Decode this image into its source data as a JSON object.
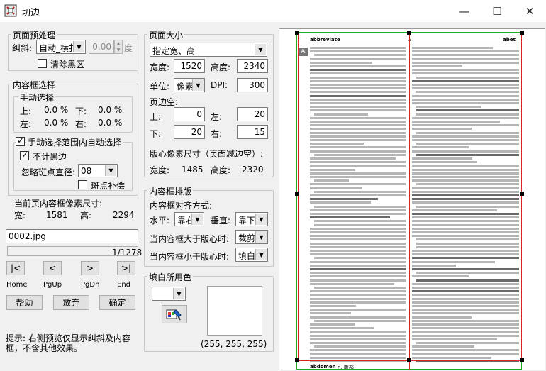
{
  "window": {
    "title": "切边"
  },
  "prep": {
    "group_title": "页面预处理",
    "skew_label": "纠斜:",
    "skew_mode": "自动_横扌",
    "skew_value": "0.00",
    "skew_unit": "度",
    "clear_black_label": "清除黑区"
  },
  "content_select": {
    "group_title": "内容框选择",
    "manual_title": "手动选择",
    "top_label": "上:",
    "top_value": "0.0 %",
    "bottom_label": "下:",
    "bottom_value": "0.0 %",
    "left_label": "左:",
    "left_value": "0.0 %",
    "right_label": "右:",
    "right_value": "0.0 %",
    "auto_label": "手动选择范围内自动选择",
    "exclude_border_label": "不计黑边",
    "ignore_dot_label": "忽略斑点直径:",
    "ignore_dot_value": "08",
    "dot_fill_label": "斑点补偿"
  },
  "current_size": {
    "label": "当前页内容框像素尺寸:",
    "width_label": "宽:",
    "width_value": "1581",
    "height_label": "高:",
    "height_value": "2294"
  },
  "file": {
    "name": "0002.jpg",
    "counter": "1/1278"
  },
  "nav": {
    "home": "Home",
    "pgup": "PgUp",
    "pgdn": "PgDn",
    "end": "End"
  },
  "buttons": {
    "help": "帮助",
    "abort": "放弃",
    "ok": "确定"
  },
  "hint": "提示: 右侧预览仅显示纠斜及内容框，不含其他效果。",
  "page_size": {
    "group_title": "页面大小",
    "mode": "指定宽、高",
    "width_label": "宽度:",
    "width_value": "1520",
    "height_label": "高度:",
    "height_value": "2340",
    "unit_label": "单位:",
    "unit_value": "像素",
    "dpi_label": "DPI:",
    "dpi_value": "300",
    "margin_title": "页边空:",
    "top_label": "上:",
    "top_value": "0",
    "left_label": "左:",
    "left_value": "20",
    "bottom_label": "下:",
    "bottom_value": "20",
    "right_label": "右:",
    "right_value": "15",
    "layout_size_label": "版心像素尺寸（页面减边空）:",
    "layout_width_label": "宽度:",
    "layout_width_value": "1485",
    "layout_height_label": "高度:",
    "layout_height_value": "2320"
  },
  "arrange": {
    "group_title": "内容框排版",
    "align_title": "内容框对齐方式:",
    "h_label": "水平:",
    "h_value": "靠右",
    "v_label": "垂直:",
    "v_value": "靠下",
    "larger_label": "当内容框大于版心时:",
    "larger_value": "裁剪",
    "smaller_label": "当内容框小于版心时:",
    "smaller_value": "填白"
  },
  "fill": {
    "label": "填白所用色",
    "rgb": "(255, 255, 255)",
    "color": "#ffffff"
  },
  "preview": {
    "header_left": "abbreviate",
    "header_center": "2",
    "header_right": "abet",
    "footer_left": "abdomen",
    "footer_right": "n.  腹部"
  },
  "colors": {
    "frame_green": "#22aa22",
    "frame_red": "#dd2222"
  }
}
